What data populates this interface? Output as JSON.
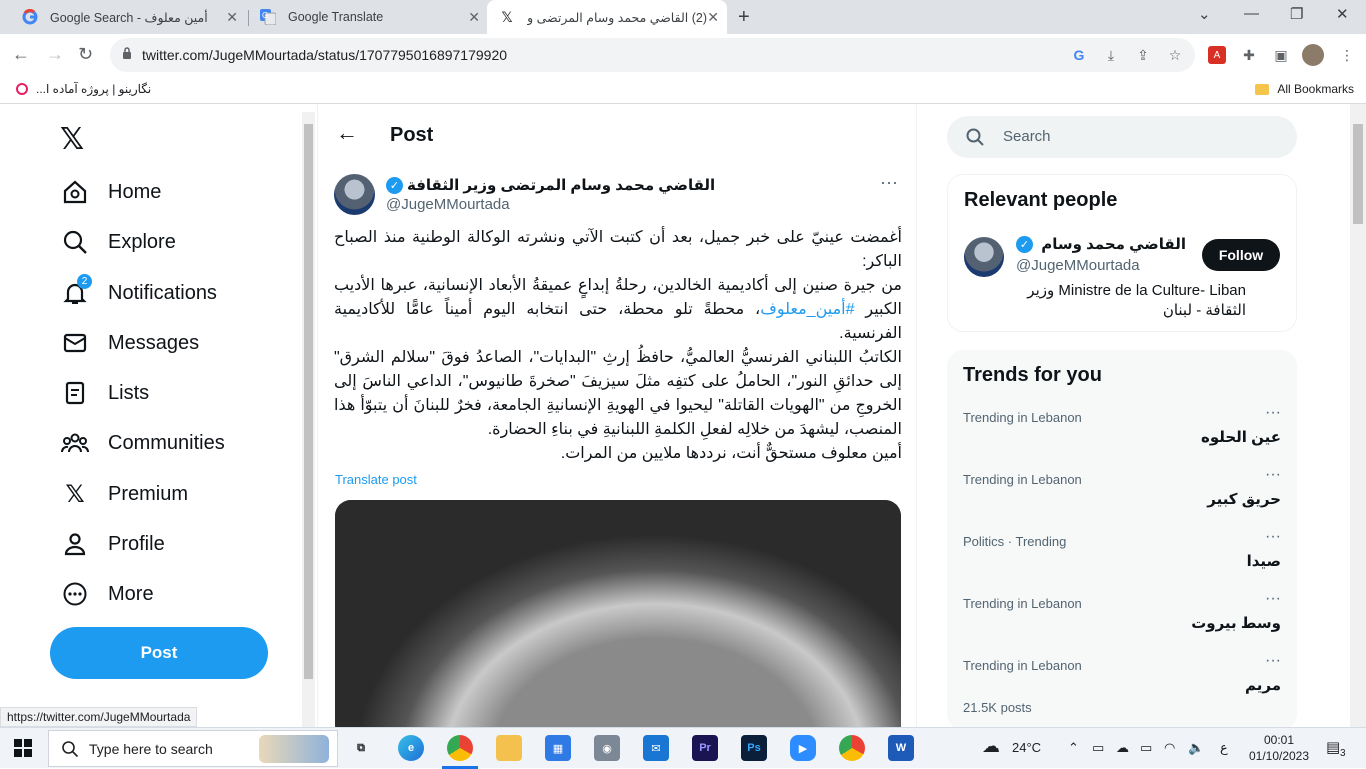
{
  "browser": {
    "tabs": [
      {
        "title": "Google Search - أمين معلوف",
        "icon": "google-icon"
      },
      {
        "title": "Google Translate",
        "icon": "google-translate-icon"
      },
      {
        "title": "(2) القاضي محمد وسام المرتضى وز",
        "icon": "x-icon"
      }
    ],
    "url": "twitter.com/JugeMMourtada/status/1707795016897179920",
    "bookmarks_left": "نگارینو | پروژه آماده ا...",
    "bookmarks_right": "All Bookmarks",
    "status_url": "https://twitter.com/JugeMMourtada"
  },
  "sidebar": {
    "items": [
      {
        "label": "Home",
        "icon": "home-icon"
      },
      {
        "label": "Explore",
        "icon": "search-icon"
      },
      {
        "label": "Notifications",
        "icon": "bell-icon",
        "badge": "2"
      },
      {
        "label": "Messages",
        "icon": "mail-icon"
      },
      {
        "label": "Lists",
        "icon": "list-icon"
      },
      {
        "label": "Communities",
        "icon": "people-icon"
      },
      {
        "label": "Premium",
        "icon": "x-icon"
      },
      {
        "label": "Profile",
        "icon": "person-icon"
      },
      {
        "label": "More",
        "icon": "more-circle-icon"
      }
    ],
    "post_button": "Post"
  },
  "main": {
    "title": "Post",
    "author_name": "القاضي محمد وسام المرتضى وزير الثقافة",
    "author_handle": "@JugeMMourtada",
    "text_p1": "أغمضت عينيّ على خبر جميل، بعد أن كتبت الآتي ونشرته الوكالة الوطنية منذ الصباح الباكر:",
    "text_p2_a": "من جيرة صنين إلى أكاديمية الخالدين، رحلةُ إبداعٍ عميقةُ الأبعاد الإنسانية، عبرها الأديب الكبير ",
    "text_p2_hashtag": "#أمين_معلوف",
    "text_p2_b": "، محطةً تلو محطة، حتى انتخابه اليوم أميناً عامًّا للأكاديمية الفرنسية.",
    "text_p3": "الكاتبُ اللبناني الفرنسيُّ العالميُّ، حافظُ إرثِ \"البدايات\"، الصاعدُ فوقَ \"سلالم الشرق\" إلى حدائقِ النور\"، الحاملُ على كتفِه مثلَ سيزيفَ \"صخرةَ طانيوس\"، الداعي الناسَ إلى الخروجِ من \"الهويات القاتلة\" ليحيوا في الهويةِ الإنسانيةِ الجامعة، فخرٌ للبنانَ أن يتبوّأ هذا المنصب، ليشهدَ من خلالِه لفعلِ الكلمةِ اللبنانيةِ في بناءِ الحضارة.",
    "text_p4": "أمين معلوف مستحقٌّ أنت، نرددها ملايين من المرات.",
    "translate_label": "Translate post"
  },
  "right": {
    "search_placeholder": "Search",
    "relevant_title": "Relevant people",
    "person_name": "القاضي محمد وسام المرتضى وزير الثقافة",
    "person_handle": "@JugeMMourtada",
    "person_bio": "Ministre de la Culture- Liban وزير الثقافة - لبنان",
    "follow_label": "Follow",
    "trends_title": "Trends for you",
    "trends": [
      {
        "context": "Trending in Lebanon",
        "name": "عين الحلوه"
      },
      {
        "context": "Trending in Lebanon",
        "name": "حريق كبير"
      },
      {
        "context": "Politics · Trending",
        "name": "صيدا"
      },
      {
        "context": "Trending in Lebanon",
        "name": "وسط بيروت"
      },
      {
        "context": "Trending in Lebanon",
        "name": "مريم",
        "count": "21.5K posts"
      }
    ]
  },
  "taskbar": {
    "search_text": "Type here to search",
    "weather": "24°C",
    "lang": "ع",
    "time": "00:01",
    "date": "01/10/2023",
    "notif_count": "3"
  }
}
